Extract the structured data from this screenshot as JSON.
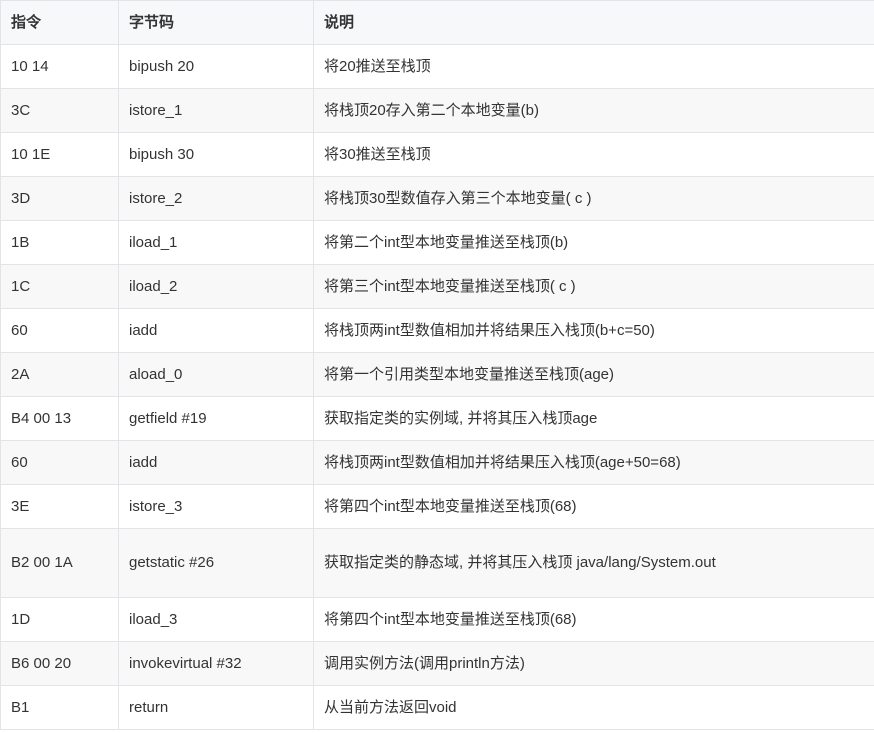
{
  "table": {
    "headers": [
      "指令",
      "字节码",
      "说明"
    ],
    "rows": [
      [
        "10 14",
        "bipush 20",
        "将20推送至栈顶"
      ],
      [
        "3C",
        "istore_1",
        "将栈顶20存入第二个本地变量(b)"
      ],
      [
        "10 1E",
        "bipush 30",
        "将30推送至栈顶"
      ],
      [
        "3D",
        "istore_2",
        "将栈顶30型数值存入第三个本地变量( c )"
      ],
      [
        "1B",
        "iload_1",
        "将第二个int型本地变量推送至栈顶(b)"
      ],
      [
        "1C",
        "iload_2",
        "将第三个int型本地变量推送至栈顶( c )"
      ],
      [
        "60",
        "iadd",
        "将栈顶两int型数值相加并将结果压入栈顶(b+c=50)"
      ],
      [
        "2A",
        "aload_0",
        "将第一个引用类型本地变量推送至栈顶(age)"
      ],
      [
        "B4 00 13",
        "getfield #19",
        "获取指定类的实例域, 并将其压入栈顶age"
      ],
      [
        "60",
        "iadd",
        "将栈顶两int型数值相加并将结果压入栈顶(age+50=68)"
      ],
      [
        "3E",
        "istore_3",
        "将第四个int型本地变量推送至栈顶(68)"
      ],
      [
        "B2 00 1A",
        "getstatic #26",
        "获取指定类的静态域, 并将其压入栈顶 java/lang/System.out"
      ],
      [
        "1D",
        "iload_3",
        "将第四个int型本地变量推送至栈顶(68)"
      ],
      [
        "B6 00 20",
        "invokevirtual #32",
        "调用实例方法(调用println方法)"
      ],
      [
        "B1",
        "return",
        "从当前方法返回void"
      ]
    ]
  }
}
